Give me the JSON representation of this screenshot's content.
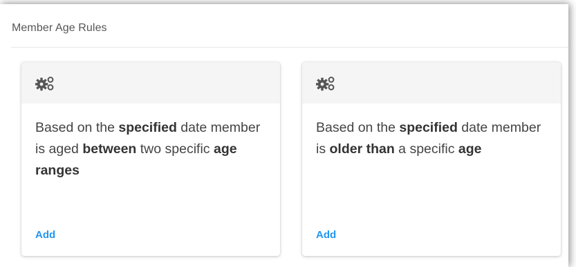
{
  "panel": {
    "title": "Member Age Rules"
  },
  "cards": [
    {
      "icon": "gears-icon",
      "text": {
        "p1": "Based on the ",
        "b1": "specified",
        "p2": " date member is aged ",
        "b2": "between",
        "p3": " two specific ",
        "b3": "age ranges",
        "p4": ""
      },
      "action_label": "Add"
    },
    {
      "icon": "gears-icon",
      "text": {
        "p1": "Based on the ",
        "b1": "specified",
        "p2": " date member is ",
        "b2": "older than",
        "p3": " a specific ",
        "b3": "age",
        "p4": ""
      },
      "action_label": "Add"
    }
  ],
  "colors": {
    "link": "#2196f3",
    "card_header_bg": "#f5f5f5",
    "icon": "#555555"
  }
}
